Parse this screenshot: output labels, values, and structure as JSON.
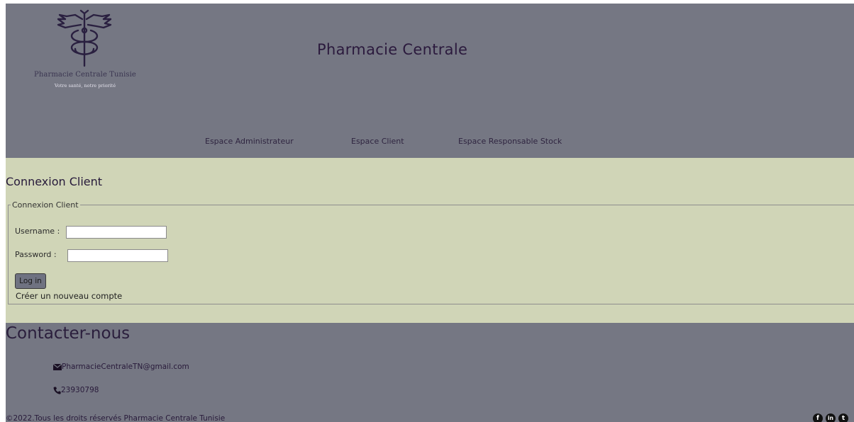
{
  "header": {
    "logo": {
      "name": "Pharmacie Centrale Tunisie",
      "slogan": "Votre santé, notre priorité"
    },
    "title": "Pharmacie Centrale",
    "nav": [
      {
        "label": "Espace Administrateur"
      },
      {
        "label": "Espace Client"
      },
      {
        "label": "Espace Responsable Stock"
      }
    ]
  },
  "main": {
    "title": "Connexion Client",
    "form": {
      "legend": "Connexion Client",
      "username_label": "Username :",
      "username_value": "",
      "password_label": "Password :",
      "password_value": "",
      "submit_label": "Log in",
      "register_link": "Créer un nouveau compte"
    }
  },
  "contact": {
    "title": "Contacter-nous",
    "email": "PharmacieCentraleTN@gmail.com",
    "phone": "23930798",
    "email_icon": "envelope-icon",
    "phone_icon": "phone-icon"
  },
  "footer": {
    "copyright": "©2022.Tous les droits réservés Pharmacie Centrale Tunisie",
    "social": [
      {
        "icon": "facebook-icon",
        "glyph": "f"
      },
      {
        "icon": "linkedin-icon",
        "glyph": "in"
      },
      {
        "icon": "twitter-icon",
        "glyph": "t"
      }
    ]
  },
  "colors": {
    "header_bg": "#757783",
    "main_bg": "#d0d5b7",
    "text_dark": "#2b1a3d"
  }
}
